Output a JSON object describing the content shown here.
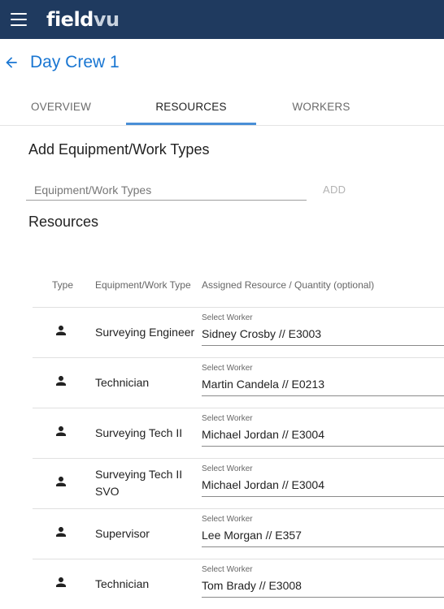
{
  "app": {
    "logo_primary": "field",
    "logo_secondary": "vu"
  },
  "header": {
    "title": "Day Crew 1"
  },
  "tabs": [
    {
      "label": "OVERVIEW",
      "active": false
    },
    {
      "label": "RESOURCES",
      "active": true
    },
    {
      "label": "WORKERS",
      "active": false
    }
  ],
  "add_section": {
    "title": "Add Equipment/Work Types",
    "input_placeholder": "Equipment/Work Types",
    "input_value": "",
    "add_label": "ADD"
  },
  "resources": {
    "title": "Resources",
    "columns": [
      "Type",
      "Equipment/Work Type",
      "Assigned Resource / Quantity (optional)"
    ],
    "rows": [
      {
        "type_icon": "person-icon",
        "equipment_type": "Surveying Engineer",
        "caption": "Select Worker",
        "assigned": "Sidney Crosby // E3003"
      },
      {
        "type_icon": "person-icon",
        "equipment_type": "Technician",
        "caption": "Select Worker",
        "assigned": "Martin Candela // E0213"
      },
      {
        "type_icon": "person-icon",
        "equipment_type": "Surveying Tech II",
        "caption": "Select Worker",
        "assigned": "Michael Jordan // E3004"
      },
      {
        "type_icon": "person-icon",
        "equipment_type": "Surveying Tech II SVO",
        "caption": "Select Worker",
        "assigned": "Michael Jordan // E3004"
      },
      {
        "type_icon": "person-icon",
        "equipment_type": "Supervisor",
        "caption": "Select Worker",
        "assigned": "Lee Morgan // E357"
      },
      {
        "type_icon": "person-icon",
        "equipment_type": "Technician",
        "caption": "Select Worker",
        "assigned": "Tom Brady // E3008"
      }
    ]
  },
  "colors": {
    "appbar": "#1f3a5f",
    "accent": "#1976d2",
    "tab_indicator": "#4a8fd6"
  }
}
